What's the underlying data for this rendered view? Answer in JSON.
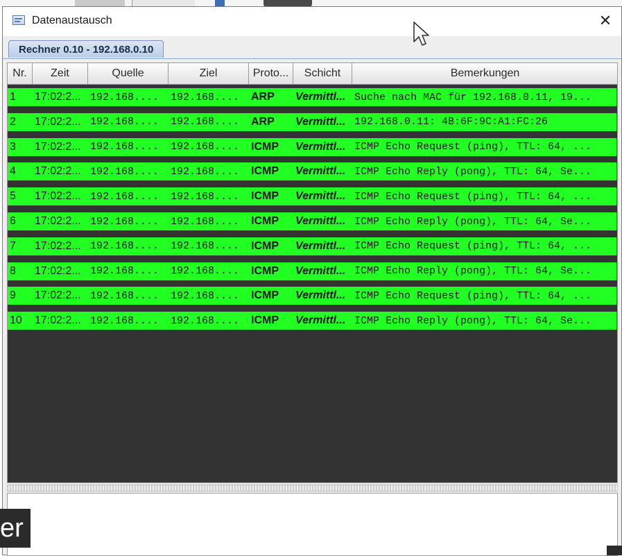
{
  "window": {
    "title": "Datenaustausch",
    "close_glyph": "✕"
  },
  "tab": {
    "label": "Rechner 0.10 - 192.168.0.10"
  },
  "table": {
    "columns": [
      "Nr.",
      "Zeit",
      "Quelle",
      "Ziel",
      "Proto...",
      "Schicht",
      "Bemerkungen"
    ],
    "rows": [
      {
        "nr": "1",
        "zeit": "17:02:2...",
        "quelle": "192.168....",
        "ziel": "192.168....",
        "proto": "ARP",
        "schicht": "Vermittl...",
        "bemerkung": "Suche nach MAC für 192.168.0.11, 19..."
      },
      {
        "nr": "2",
        "zeit": "17:02:2...",
        "quelle": "192.168....",
        "ziel": "192.168....",
        "proto": "ARP",
        "schicht": "Vermittl...",
        "bemerkung": "192.168.0.11: 4B:6F:9C:A1:FC:26"
      },
      {
        "nr": "3",
        "zeit": "17:02:2...",
        "quelle": "192.168....",
        "ziel": "192.168....",
        "proto": "ICMP",
        "schicht": "Vermittl...",
        "bemerkung": "ICMP Echo Request (ping), TTL: 64, ..."
      },
      {
        "nr": "4",
        "zeit": "17:02:2...",
        "quelle": "192.168....",
        "ziel": "192.168....",
        "proto": "ICMP",
        "schicht": "Vermittl...",
        "bemerkung": "ICMP Echo Reply (pong), TTL: 64, Se..."
      },
      {
        "nr": "5",
        "zeit": "17:02:2...",
        "quelle": "192.168....",
        "ziel": "192.168....",
        "proto": "ICMP",
        "schicht": "Vermittl...",
        "bemerkung": "ICMP Echo Request (ping), TTL: 64, ..."
      },
      {
        "nr": "6",
        "zeit": "17:02:2...",
        "quelle": "192.168....",
        "ziel": "192.168....",
        "proto": "ICMP",
        "schicht": "Vermittl...",
        "bemerkung": "ICMP Echo Reply (pong), TTL: 64, Se..."
      },
      {
        "nr": "7",
        "zeit": "17:02:2...",
        "quelle": "192.168....",
        "ziel": "192.168....",
        "proto": "ICMP",
        "schicht": "Vermittl...",
        "bemerkung": "ICMP Echo Request (ping), TTL: 64, ..."
      },
      {
        "nr": "8",
        "zeit": "17:02:2...",
        "quelle": "192.168....",
        "ziel": "192.168....",
        "proto": "ICMP",
        "schicht": "Vermittl...",
        "bemerkung": "ICMP Echo Reply (pong), TTL: 64, Se..."
      },
      {
        "nr": "9",
        "zeit": "17:02:2...",
        "quelle": "192.168....",
        "ziel": "192.168....",
        "proto": "ICMP",
        "schicht": "Vermittl...",
        "bemerkung": "ICMP Echo Request (ping), TTL: 64, ..."
      },
      {
        "nr": "10",
        "zeit": "17:02:2...",
        "quelle": "192.168....",
        "ziel": "192.168....",
        "proto": "ICMP",
        "schicht": "Vermittl...",
        "bemerkung": "ICMP Echo Reply (pong), TTL: 64, Se..."
      }
    ]
  },
  "overlay": {
    "text": "er"
  },
  "colors": {
    "row_background": "#22ff22",
    "table_background": "#333333",
    "tab_background": "#c8d8ee"
  },
  "icons": {
    "app": "window-icon",
    "close": "close-icon",
    "cursor": "mouse-pointer-icon"
  }
}
